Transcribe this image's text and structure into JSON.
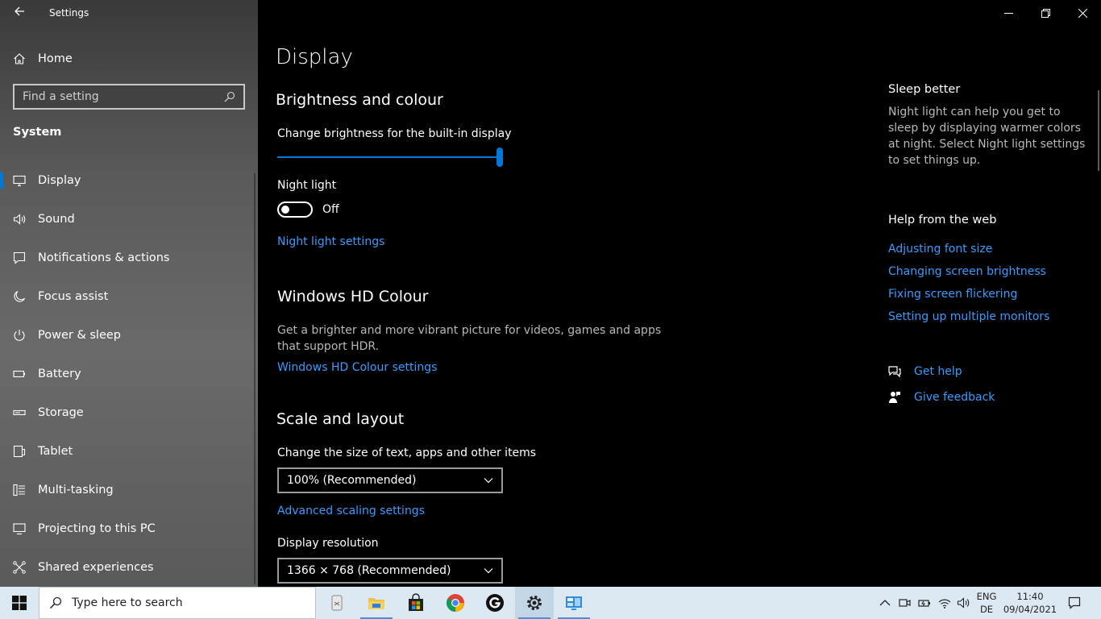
{
  "window": {
    "title": "Settings",
    "back_icon": "arrow-left-icon",
    "controls": [
      "minimize-icon",
      "restore-icon",
      "close-icon"
    ]
  },
  "sidebar": {
    "home_label": "Home",
    "search_placeholder": "Find a setting",
    "section_title": "System",
    "items": [
      {
        "label": "Display",
        "icon": "monitor-icon",
        "active": true
      },
      {
        "label": "Sound",
        "icon": "speaker-icon"
      },
      {
        "label": "Notifications & actions",
        "icon": "notification-icon"
      },
      {
        "label": "Focus assist",
        "icon": "moon-icon"
      },
      {
        "label": "Power & sleep",
        "icon": "power-icon"
      },
      {
        "label": "Battery",
        "icon": "battery-icon"
      },
      {
        "label": "Storage",
        "icon": "storage-icon"
      },
      {
        "label": "Tablet",
        "icon": "tablet-icon"
      },
      {
        "label": "Multi-tasking",
        "icon": "multitasking-icon"
      },
      {
        "label": "Projecting to this PC",
        "icon": "projecting-icon"
      },
      {
        "label": "Shared experiences",
        "icon": "shared-icon"
      }
    ]
  },
  "main": {
    "page_title": "Display",
    "brightness": {
      "heading": "Brightness and colour",
      "slider_label": "Change brightness for the built-in display",
      "slider_value": 1.0
    },
    "night_light": {
      "label": "Night light",
      "state": "Off",
      "settings_link": "Night light settings"
    },
    "hd_colour": {
      "heading": "Windows HD Colour",
      "description_line1": "Get a brighter and more vibrant picture for videos, games and apps",
      "description_line2": "that support HDR.",
      "link": "Windows HD Colour settings"
    },
    "scale": {
      "heading": "Scale and layout",
      "size_label": "Change the size of text, apps and other items",
      "size_value": "100% (Recommended)",
      "advanced_link": "Advanced scaling settings",
      "resolution_label": "Display resolution",
      "resolution_value": "1366 × 768 (Recommended)"
    }
  },
  "right_panel": {
    "sleep_title": "Sleep better",
    "sleep_text": "Night light can help you get to sleep by displaying warmer colors at night. Select Night light settings to set things up.",
    "help_title": "Help from the web",
    "links": [
      "Adjusting font size",
      "Changing screen brightness",
      "Fixing screen flickering",
      "Setting up multiple monitors"
    ],
    "get_help": "Get help",
    "give_feedback": "Give feedback"
  },
  "taskbar": {
    "search_placeholder": "Type here to search",
    "apps": [
      "task-view-icon",
      "file-explorer-icon",
      "store-icon",
      "chrome-icon",
      "g-app-icon",
      "settings-gear-icon",
      "control-panel-icon"
    ],
    "tray": [
      "chevron-up-icon",
      "meet-now-icon",
      "battery-charging-icon",
      "wifi-icon",
      "volume-icon"
    ],
    "lang_line1": "ENG",
    "lang_line2": "DE",
    "time": "11:40",
    "date": "09/04/2021"
  }
}
